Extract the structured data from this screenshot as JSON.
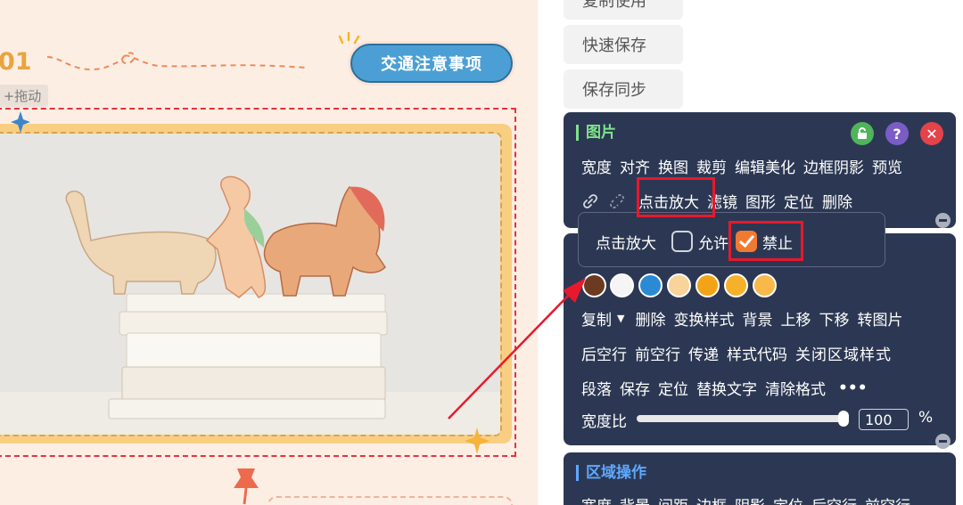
{
  "canvas": {
    "number_label": "01",
    "title_pill": "交通注意事项",
    "hint_tag": "+拖动"
  },
  "side_buttons": [
    "复制使用",
    "快速保存",
    "保存同步"
  ],
  "image_panel": {
    "title": "图片",
    "row1": [
      "宽度",
      "对齐",
      "换图",
      "裁剪",
      "编辑美化",
      "边框阴影",
      "预览"
    ],
    "row2": [
      "点击放大",
      "滤镜",
      "图形",
      "定位",
      "删除"
    ]
  },
  "zoom_popup": {
    "label": "点击放大",
    "allow_label": "允许",
    "forbid_label": "禁止",
    "allow_checked": false,
    "forbid_checked": true
  },
  "style_panel": {
    "swatch_colors": [
      "#6b3a20",
      "#f5f5f5",
      "#2b8ad3",
      "#f8d39a",
      "#f3a316",
      "#f6b12a",
      "#f8b84a"
    ],
    "row1": [
      "复制",
      "删除",
      "变换样式",
      "背景",
      "上移",
      "下移",
      "转图片"
    ],
    "row2": [
      "后空行",
      "前空行",
      "传递",
      "样式代码",
      "关闭区域样式"
    ],
    "row3": [
      "段落",
      "保存",
      "定位",
      "替换文字",
      "清除格式"
    ],
    "more": "•••",
    "width_ratio_label": "宽度比",
    "width_ratio_value": "100",
    "width_ratio_unit": "%"
  },
  "region_panel": {
    "title": "区域操作",
    "row1": [
      "宽度",
      "背景",
      "间距",
      "边框",
      "阴影",
      "定位",
      "后空行",
      "前空行"
    ]
  },
  "colors": {
    "accent_green": "#7ee48a",
    "accent_blue": "#5ea8ff",
    "panel_bg": "#2c3853",
    "highlight_red": "#e8192c",
    "checkbox_orange": "#f17a32"
  }
}
